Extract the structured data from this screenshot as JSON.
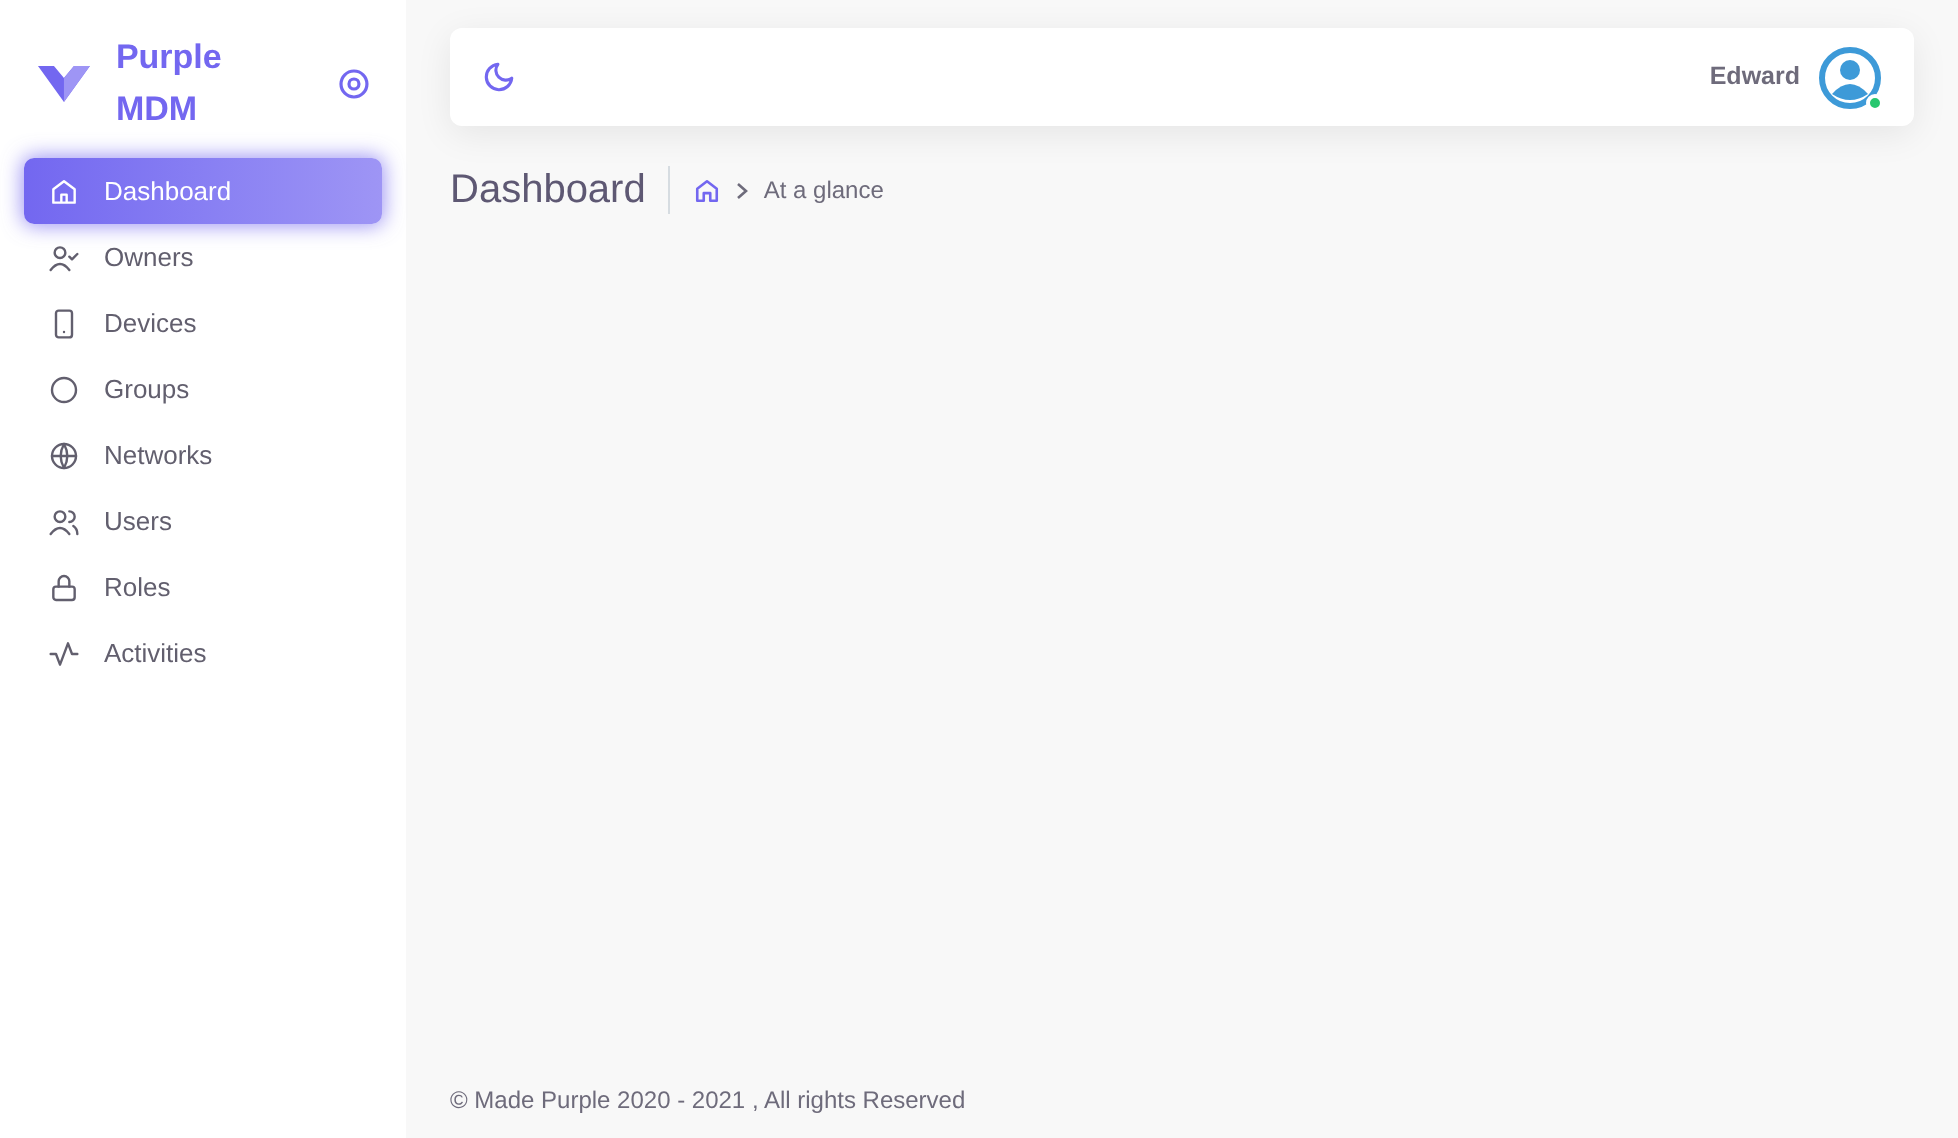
{
  "brand": {
    "name": "Purple MDM"
  },
  "sidebar": {
    "items": [
      {
        "label": "Dashboard",
        "selected": true
      },
      {
        "label": "Owners",
        "selected": false
      },
      {
        "label": "Devices",
        "selected": false
      },
      {
        "label": "Groups",
        "selected": false
      },
      {
        "label": "Networks",
        "selected": false
      },
      {
        "label": "Users",
        "selected": false
      },
      {
        "label": "Roles",
        "selected": false
      },
      {
        "label": "Activities",
        "selected": false
      }
    ]
  },
  "header": {
    "user": {
      "name": "Edward",
      "online": true
    }
  },
  "page": {
    "title": "Dashboard",
    "breadcrumb": [
      "At a glance"
    ]
  },
  "footer": "© Made Purple 2020 - 2021 , All rights Reserved"
}
